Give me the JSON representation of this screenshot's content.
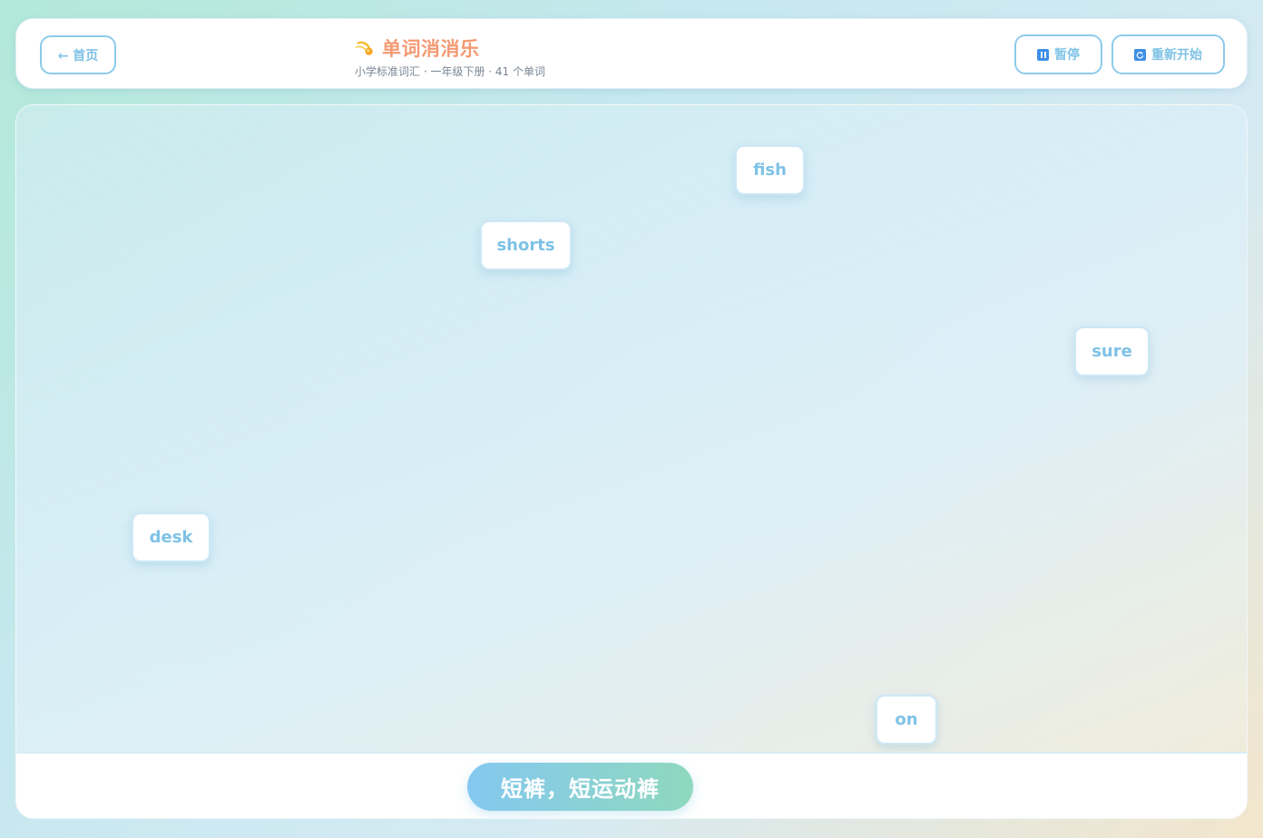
{
  "header": {
    "home_label": "← 首页",
    "title": "单词消消乐",
    "subtitle": "小学标准词汇 · 一年级下册 · 41 个单词",
    "pause_label": "暂停",
    "restart_label": "重新开始",
    "pause_icon": "pause-icon",
    "restart_icon": "refresh-icon",
    "title_icon": "comet-icon"
  },
  "words": [
    "fish",
    "shorts",
    "sure",
    "desk",
    "on"
  ],
  "target_meaning": "短裤，短运动裤",
  "colors": {
    "accent_blue": "#7ec2e6",
    "title_orange": "#f49a73",
    "icon_blue": "#3d8ee6"
  }
}
